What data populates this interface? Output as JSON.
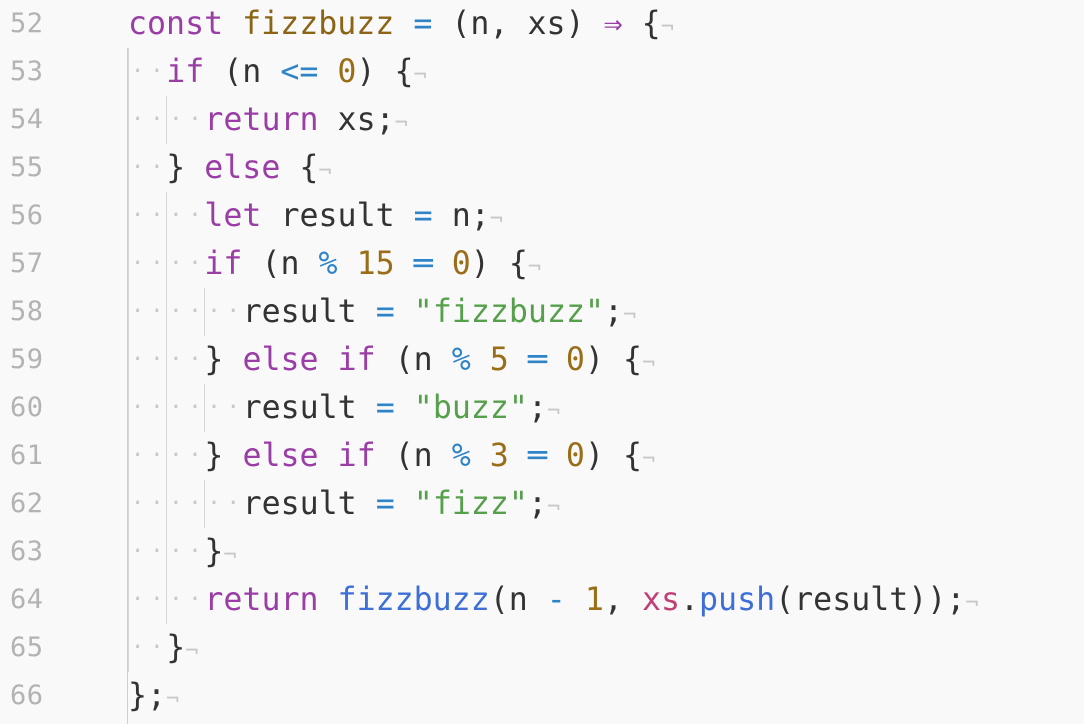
{
  "editor": {
    "eol_marker": "¬",
    "lines": [
      {
        "number": "52",
        "indent": 0,
        "tokens": [
          {
            "t": "const",
            "c": "kw"
          },
          {
            "t": " ",
            "c": "sp"
          },
          {
            "t": "fizzbuzz",
            "c": "fn"
          },
          {
            "t": " ",
            "c": "sp"
          },
          {
            "t": "=",
            "c": "op"
          },
          {
            "t": " ",
            "c": "sp"
          },
          {
            "t": "(n, xs)",
            "c": "punc"
          },
          {
            "t": " ",
            "c": "sp"
          },
          {
            "t": "⇒",
            "c": "kw"
          },
          {
            "t": " ",
            "c": "sp"
          },
          {
            "t": "{",
            "c": "punc"
          }
        ]
      },
      {
        "number": "53",
        "indent": 1,
        "tokens": [
          {
            "t": "if",
            "c": "kw"
          },
          {
            "t": " ",
            "c": "sp"
          },
          {
            "t": "(n",
            "c": "punc"
          },
          {
            "t": " ",
            "c": "sp"
          },
          {
            "t": "<=",
            "c": "op"
          },
          {
            "t": " ",
            "c": "sp"
          },
          {
            "t": "0",
            "c": "num"
          },
          {
            "t": ")",
            "c": "punc"
          },
          {
            "t": " ",
            "c": "sp"
          },
          {
            "t": "{",
            "c": "punc"
          }
        ]
      },
      {
        "number": "54",
        "indent": 2,
        "tokens": [
          {
            "t": "return",
            "c": "kw"
          },
          {
            "t": " ",
            "c": "sp"
          },
          {
            "t": "xs;",
            "c": "id"
          }
        ]
      },
      {
        "number": "55",
        "indent": 1,
        "tokens": [
          {
            "t": "}",
            "c": "punc"
          },
          {
            "t": " ",
            "c": "sp"
          },
          {
            "t": "else",
            "c": "kw"
          },
          {
            "t": " ",
            "c": "sp"
          },
          {
            "t": "{",
            "c": "punc"
          }
        ]
      },
      {
        "number": "56",
        "indent": 2,
        "tokens": [
          {
            "t": "let",
            "c": "kw"
          },
          {
            "t": " ",
            "c": "sp"
          },
          {
            "t": "result",
            "c": "id"
          },
          {
            "t": " ",
            "c": "sp"
          },
          {
            "t": "=",
            "c": "op"
          },
          {
            "t": " ",
            "c": "sp"
          },
          {
            "t": "n;",
            "c": "id"
          }
        ]
      },
      {
        "number": "57",
        "indent": 2,
        "tokens": [
          {
            "t": "if",
            "c": "kw"
          },
          {
            "t": " ",
            "c": "sp"
          },
          {
            "t": "(n",
            "c": "punc"
          },
          {
            "t": " ",
            "c": "sp"
          },
          {
            "t": "%",
            "c": "op"
          },
          {
            "t": " ",
            "c": "sp"
          },
          {
            "t": "15",
            "c": "num"
          },
          {
            "t": " ",
            "c": "sp"
          },
          {
            "t": "═",
            "c": "op"
          },
          {
            "t": " ",
            "c": "sp"
          },
          {
            "t": "0",
            "c": "num"
          },
          {
            "t": ")",
            "c": "punc"
          },
          {
            "t": " ",
            "c": "sp"
          },
          {
            "t": "{",
            "c": "punc"
          }
        ]
      },
      {
        "number": "58",
        "indent": 3,
        "tokens": [
          {
            "t": "result",
            "c": "id"
          },
          {
            "t": " ",
            "c": "sp"
          },
          {
            "t": "=",
            "c": "op"
          },
          {
            "t": " ",
            "c": "sp"
          },
          {
            "t": "\"fizzbuzz\"",
            "c": "str"
          },
          {
            "t": ";",
            "c": "punc"
          }
        ]
      },
      {
        "number": "59",
        "indent": 2,
        "tokens": [
          {
            "t": "}",
            "c": "punc"
          },
          {
            "t": " ",
            "c": "sp"
          },
          {
            "t": "else",
            "c": "kw"
          },
          {
            "t": " ",
            "c": "sp"
          },
          {
            "t": "if",
            "c": "kw"
          },
          {
            "t": " ",
            "c": "sp"
          },
          {
            "t": "(n",
            "c": "punc"
          },
          {
            "t": " ",
            "c": "sp"
          },
          {
            "t": "%",
            "c": "op"
          },
          {
            "t": " ",
            "c": "sp"
          },
          {
            "t": "5",
            "c": "num"
          },
          {
            "t": " ",
            "c": "sp"
          },
          {
            "t": "═",
            "c": "op"
          },
          {
            "t": " ",
            "c": "sp"
          },
          {
            "t": "0",
            "c": "num"
          },
          {
            "t": ")",
            "c": "punc"
          },
          {
            "t": " ",
            "c": "sp"
          },
          {
            "t": "{",
            "c": "punc"
          }
        ]
      },
      {
        "number": "60",
        "indent": 3,
        "tokens": [
          {
            "t": "result",
            "c": "id"
          },
          {
            "t": " ",
            "c": "sp"
          },
          {
            "t": "=",
            "c": "op"
          },
          {
            "t": " ",
            "c": "sp"
          },
          {
            "t": "\"buzz\"",
            "c": "str"
          },
          {
            "t": ";",
            "c": "punc"
          }
        ]
      },
      {
        "number": "61",
        "indent": 2,
        "tokens": [
          {
            "t": "}",
            "c": "punc"
          },
          {
            "t": " ",
            "c": "sp"
          },
          {
            "t": "else",
            "c": "kw"
          },
          {
            "t": " ",
            "c": "sp"
          },
          {
            "t": "if",
            "c": "kw"
          },
          {
            "t": " ",
            "c": "sp"
          },
          {
            "t": "(n",
            "c": "punc"
          },
          {
            "t": " ",
            "c": "sp"
          },
          {
            "t": "%",
            "c": "op"
          },
          {
            "t": " ",
            "c": "sp"
          },
          {
            "t": "3",
            "c": "num"
          },
          {
            "t": " ",
            "c": "sp"
          },
          {
            "t": "═",
            "c": "op"
          },
          {
            "t": " ",
            "c": "sp"
          },
          {
            "t": "0",
            "c": "num"
          },
          {
            "t": ")",
            "c": "punc"
          },
          {
            "t": " ",
            "c": "sp"
          },
          {
            "t": "{",
            "c": "punc"
          }
        ]
      },
      {
        "number": "62",
        "indent": 3,
        "tokens": [
          {
            "t": "result",
            "c": "id"
          },
          {
            "t": " ",
            "c": "sp"
          },
          {
            "t": "=",
            "c": "op"
          },
          {
            "t": " ",
            "c": "sp"
          },
          {
            "t": "\"fizz\"",
            "c": "str"
          },
          {
            "t": ";",
            "c": "punc"
          }
        ]
      },
      {
        "number": "63",
        "indent": 2,
        "tokens": [
          {
            "t": "}",
            "c": "punc"
          }
        ]
      },
      {
        "number": "64",
        "indent": 2,
        "tokens": [
          {
            "t": "return",
            "c": "kw"
          },
          {
            "t": " ",
            "c": "sp"
          },
          {
            "t": "fizzbuzz",
            "c": "call"
          },
          {
            "t": "(n",
            "c": "punc"
          },
          {
            "t": " ",
            "c": "sp"
          },
          {
            "t": "-",
            "c": "op"
          },
          {
            "t": " ",
            "c": "sp"
          },
          {
            "t": "1",
            "c": "num"
          },
          {
            "t": ",",
            "c": "punc"
          },
          {
            "t": " ",
            "c": "sp"
          },
          {
            "t": "xs",
            "c": "prop"
          },
          {
            "t": ".",
            "c": "punc"
          },
          {
            "t": "push",
            "c": "call"
          },
          {
            "t": "(result));",
            "c": "punc"
          }
        ]
      },
      {
        "number": "65",
        "indent": 1,
        "tokens": [
          {
            "t": "}",
            "c": "punc"
          }
        ]
      },
      {
        "number": "66",
        "indent": 0,
        "tokens": [
          {
            "t": "};",
            "c": "punc"
          }
        ]
      }
    ]
  },
  "colors": {
    "background": "#f9f9f9",
    "keyword": "#9a3ea6",
    "function_name": "#8b6416",
    "call": "#3d6fd6",
    "operator": "#2f84c8",
    "number": "#9a6e19",
    "string": "#56a04c",
    "property": "#c13f77",
    "text": "#333333",
    "line_number": "#b3b3b3",
    "whitespace_marker": "#c8c8c8"
  }
}
